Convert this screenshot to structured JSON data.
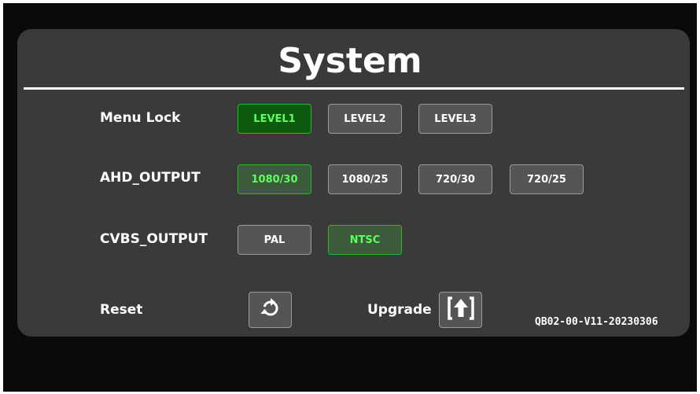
{
  "title": "System",
  "menu_lock": {
    "label": "Menu Lock",
    "options": [
      "LEVEL1",
      "LEVEL2",
      "LEVEL3"
    ],
    "selected": "LEVEL1"
  },
  "ahd_output": {
    "label": "AHD_OUTPUT",
    "options": [
      "1080/30",
      "1080/25",
      "720/30",
      "720/25"
    ],
    "selected": "1080/30"
  },
  "cvbs_output": {
    "label": "CVBS_OUTPUT",
    "options": [
      "PAL",
      "NTSC"
    ],
    "selected": "NTSC"
  },
  "reset": {
    "label": "Reset",
    "icon": "refresh-icon"
  },
  "upgrade": {
    "label": "Upgrade",
    "icon": "upload-icon"
  },
  "version": "QB02-00-V11-20230306",
  "colors": {
    "selected_text": "#5cff5c",
    "selected_border": "#28b828",
    "button_bg": "#555555",
    "panel_bg": "#3a3a3a"
  }
}
